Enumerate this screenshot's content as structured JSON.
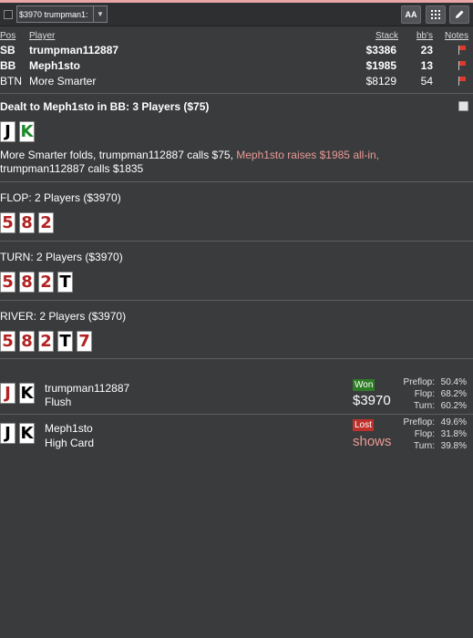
{
  "toolbar": {
    "player_select": "$3970 trumpman1:",
    "font_button": "AA",
    "grid_button_icon": "grid-icon",
    "edit_button_icon": "pencil-icon"
  },
  "players_table": {
    "headers": {
      "pos": "Pos",
      "player": "Player",
      "stack": "Stack",
      "bbs": "bb's",
      "notes": "Notes"
    },
    "rows": [
      {
        "pos": "SB",
        "player": "trumpman112887",
        "stack": "$3386",
        "bbs": "23"
      },
      {
        "pos": "BB",
        "player": "Meph1sto",
        "stack": "$1985",
        "bbs": "13"
      },
      {
        "pos": "BTN",
        "player": "More Smarter",
        "stack": "$8129",
        "bbs": "54"
      }
    ]
  },
  "preflop": {
    "title": "Dealt to Meph1sto in BB: 3 Players ($75)",
    "hero_cards": [
      "J",
      "K"
    ],
    "action_text": "More Smarter folds, trumpman112887 calls $75, ",
    "action_highlight": "Meph1sto raises $1985 all-in,",
    "action_text_end": " trumpman112887 calls $1835"
  },
  "flop": {
    "title": "FLOP: 2 Players ($3970)",
    "cards": [
      "5",
      "8",
      "2"
    ]
  },
  "turn": {
    "title": "TURN: 2 Players ($3970)",
    "cards": [
      "5",
      "8",
      "2",
      "T"
    ]
  },
  "river": {
    "title": "RIVER: 2 Players ($3970)",
    "cards": [
      "5",
      "8",
      "2",
      "T",
      "7"
    ]
  },
  "results": [
    {
      "cards": [
        "J",
        "K"
      ],
      "name": "trumpman112887",
      "hand": "Flush",
      "status": "Won",
      "amount": "$3970",
      "equity": {
        "preflop_label": "Preflop:",
        "preflop": "50.4%",
        "flop_label": "Flop:",
        "flop": "68.2%",
        "turn_label": "Turn:",
        "turn": "60.2%"
      }
    },
    {
      "cards": [
        "J",
        "K"
      ],
      "name": "Meph1sto",
      "hand": "High Card",
      "status": "Lost",
      "amount": "shows",
      "equity": {
        "preflop_label": "Preflop:",
        "preflop": "49.6%",
        "flop_label": "Flop:",
        "flop": "31.8%",
        "turn_label": "Turn:",
        "turn": "39.8%"
      }
    }
  ],
  "colors": {
    "background": "#3a3b3d",
    "highlight_pink": "#e99a96",
    "won_badge": "#2e7d26",
    "lost_badge": "#c0302a",
    "red_card": "#b22222",
    "green_card": "#1d8a2a"
  }
}
